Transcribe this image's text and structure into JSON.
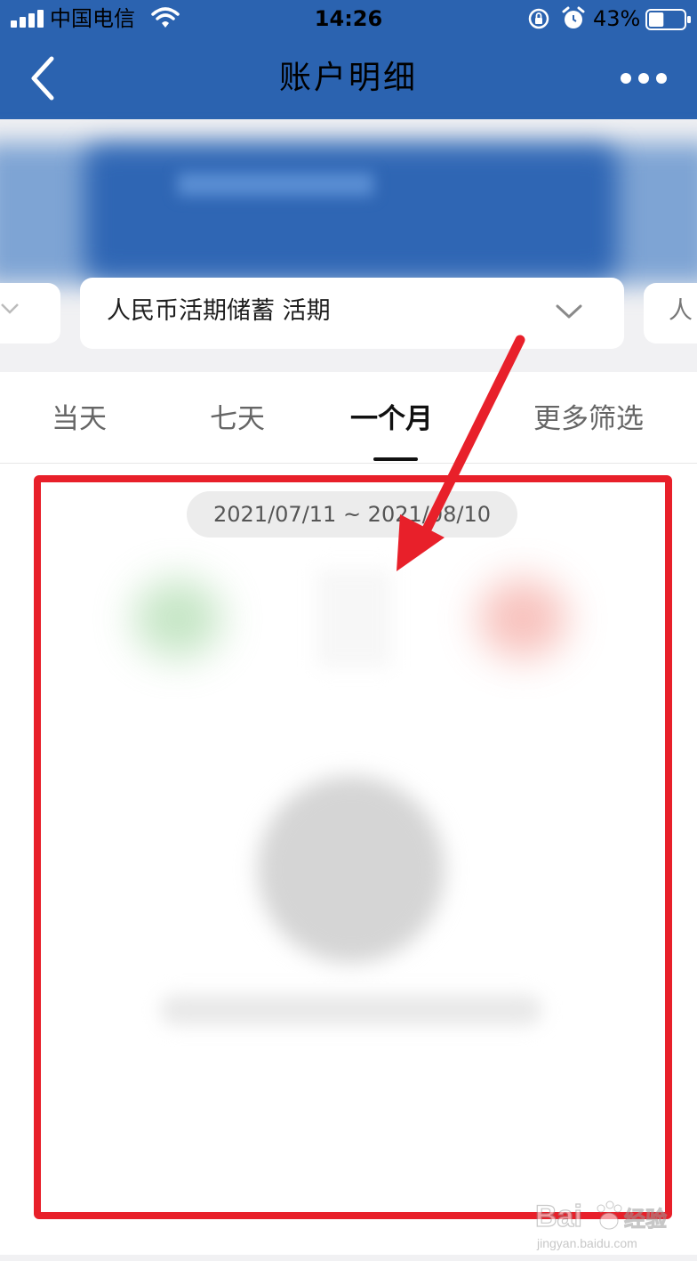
{
  "status_bar": {
    "carrier": "中国电信",
    "time": "14:26",
    "battery_percent": "43%",
    "battery_level": 0.43
  },
  "nav": {
    "title": "账户明细",
    "back_icon": "chevron-left-icon",
    "more_icon": "more-dots-icon"
  },
  "account_selector": {
    "label": "人民币活期储蓄 活期",
    "icon": "chevron-down-icon",
    "next_card_peek": "人"
  },
  "tabs": [
    {
      "label": "当天",
      "active": false
    },
    {
      "label": "七天",
      "active": false
    },
    {
      "label": "一个月",
      "active": true
    },
    {
      "label": "更多筛选",
      "active": false
    }
  ],
  "date_range": "2021/07/11 ~ 2021/08/10",
  "colors": {
    "header_blue": "#2b63b0",
    "annotation_red": "#e8202a",
    "income_green": "#b8e0b8",
    "expense_red": "#f6b3ad"
  },
  "watermark": {
    "brand": "Bai",
    "brand_suffix": "经验",
    "url": "jingyan.baidu.com"
  }
}
